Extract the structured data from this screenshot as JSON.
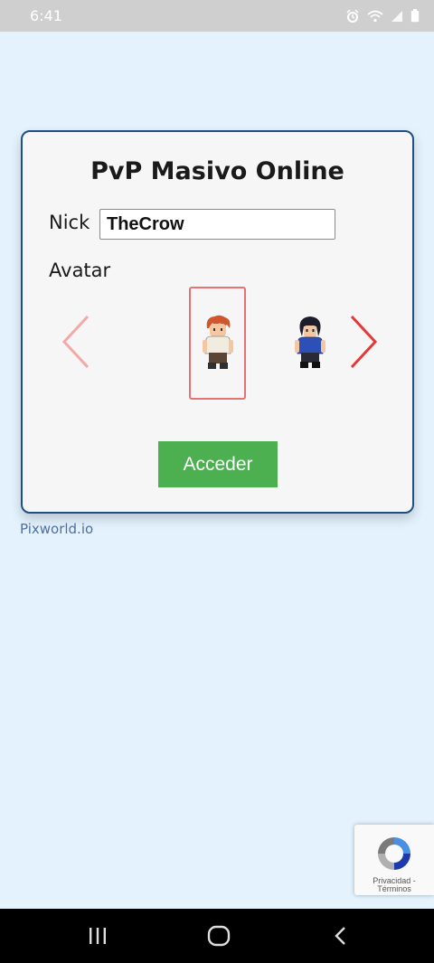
{
  "status_bar": {
    "time": "6:41",
    "icons": [
      "alarm-icon",
      "wifi-icon",
      "signal-icon",
      "battery-icon"
    ]
  },
  "card": {
    "title": "PvP Masivo Online",
    "nick_label": "Nick",
    "nick_value": "TheCrow",
    "avatar_label": "Avatar",
    "access_button": "Acceder"
  },
  "footer": {
    "site_link": "Pixworld.io"
  },
  "recaptcha": {
    "line1": "Privacidad -",
    "line2": "Términos"
  },
  "colors": {
    "page_bg": "#e3f2fd",
    "card_border": "#1f4f86",
    "accent_green": "#4caf50",
    "arrow_red": "#e53935",
    "selection_border": "#e57373"
  },
  "nav_bar": {
    "buttons": [
      "recent-apps-icon",
      "home-icon",
      "back-icon"
    ]
  }
}
